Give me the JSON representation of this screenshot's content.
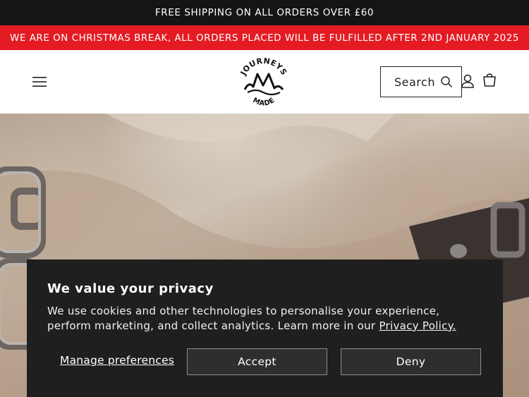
{
  "announcement": {
    "text": "FREE SHIPPING ON ALL ORDERS OVER £60"
  },
  "notice": {
    "text": "WE ARE ON CHRISTMAS BREAK, ALL ORDERS PLACED WILL BE FULFILLED AFTER 2ND JANUARY 2025",
    "color": "#e41b23"
  },
  "header": {
    "menu_icon": "hamburger-menu-icon",
    "logo": {
      "top_text": "JOURNEYS",
      "bottom_text": "MADE"
    },
    "search": {
      "label": "Search",
      "icon": "search-icon"
    },
    "account_icon": "account-icon",
    "cart_icon": "cart-icon"
  },
  "cookie_banner": {
    "title": "We value your privacy",
    "body": "We use cookies and other technologies to personalise your experience, perform marketing, and collect analytics. Learn more in our ",
    "link_text": "Privacy Policy.",
    "manage_label": "Manage preferences",
    "accept_label": "Accept",
    "deny_label": "Deny"
  }
}
